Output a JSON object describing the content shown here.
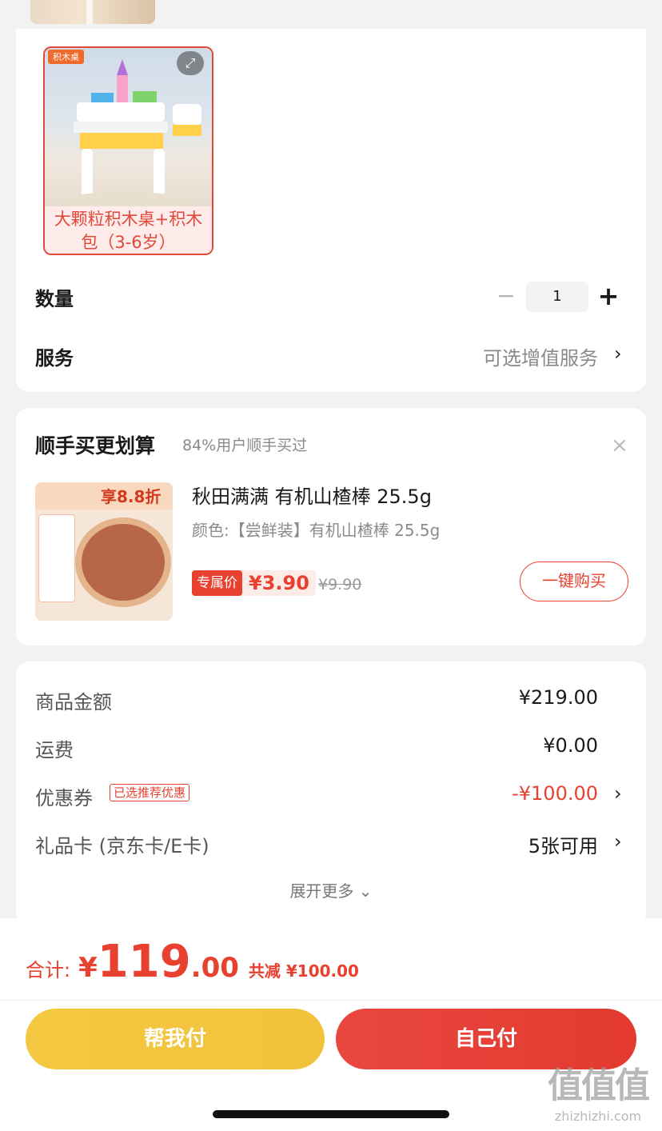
{
  "variant": {
    "badge": "积木桌",
    "label_line1": "大颗粒积木桌+积木",
    "label_line2": "包（3-6岁）"
  },
  "quantity": {
    "label": "数量",
    "minus": "−",
    "value": "1",
    "plus": "+"
  },
  "service": {
    "label": "服务",
    "value": "可选增值服务",
    "chevron": "›"
  },
  "addon": {
    "title": "顺手买更划算",
    "subtitle": "84%用户顺手买过",
    "close": "×",
    "product": {
      "image_banner": "享8.8折",
      "name": "秋田满满 有机山楂棒 25.5g",
      "variant": "颜色:【尝鲜装】有机山楂棒 25.5g",
      "price_tag": "专属价",
      "price": "¥3.90",
      "original_price": "¥9.90",
      "buy_button": "一键购买"
    }
  },
  "fees": {
    "goods_label": "商品金额",
    "goods_value": "¥219.00",
    "shipping_label": "运费",
    "shipping_value": "¥0.00",
    "coupon_label": "优惠券",
    "coupon_badge": "已选推荐优惠",
    "coupon_value": "-¥100.00",
    "giftcard_label": "礼品卡 (京东卡/E卡)",
    "giftcard_value": "5张可用",
    "chevron": "›",
    "expand_more": "展开更多 ⌄"
  },
  "total": {
    "label": "合计:",
    "yen": "¥",
    "integer": "119",
    "decimal": ".00",
    "discount": "共减 ¥100.00"
  },
  "actions": {
    "help_pay": "帮我付",
    "self_pay": "自己付"
  },
  "watermark": {
    "big": "值值值",
    "small": "zhizhizhi.com"
  },
  "colors": {
    "accent_red": "#e8412f",
    "accent_yellow": "#f5c842"
  }
}
